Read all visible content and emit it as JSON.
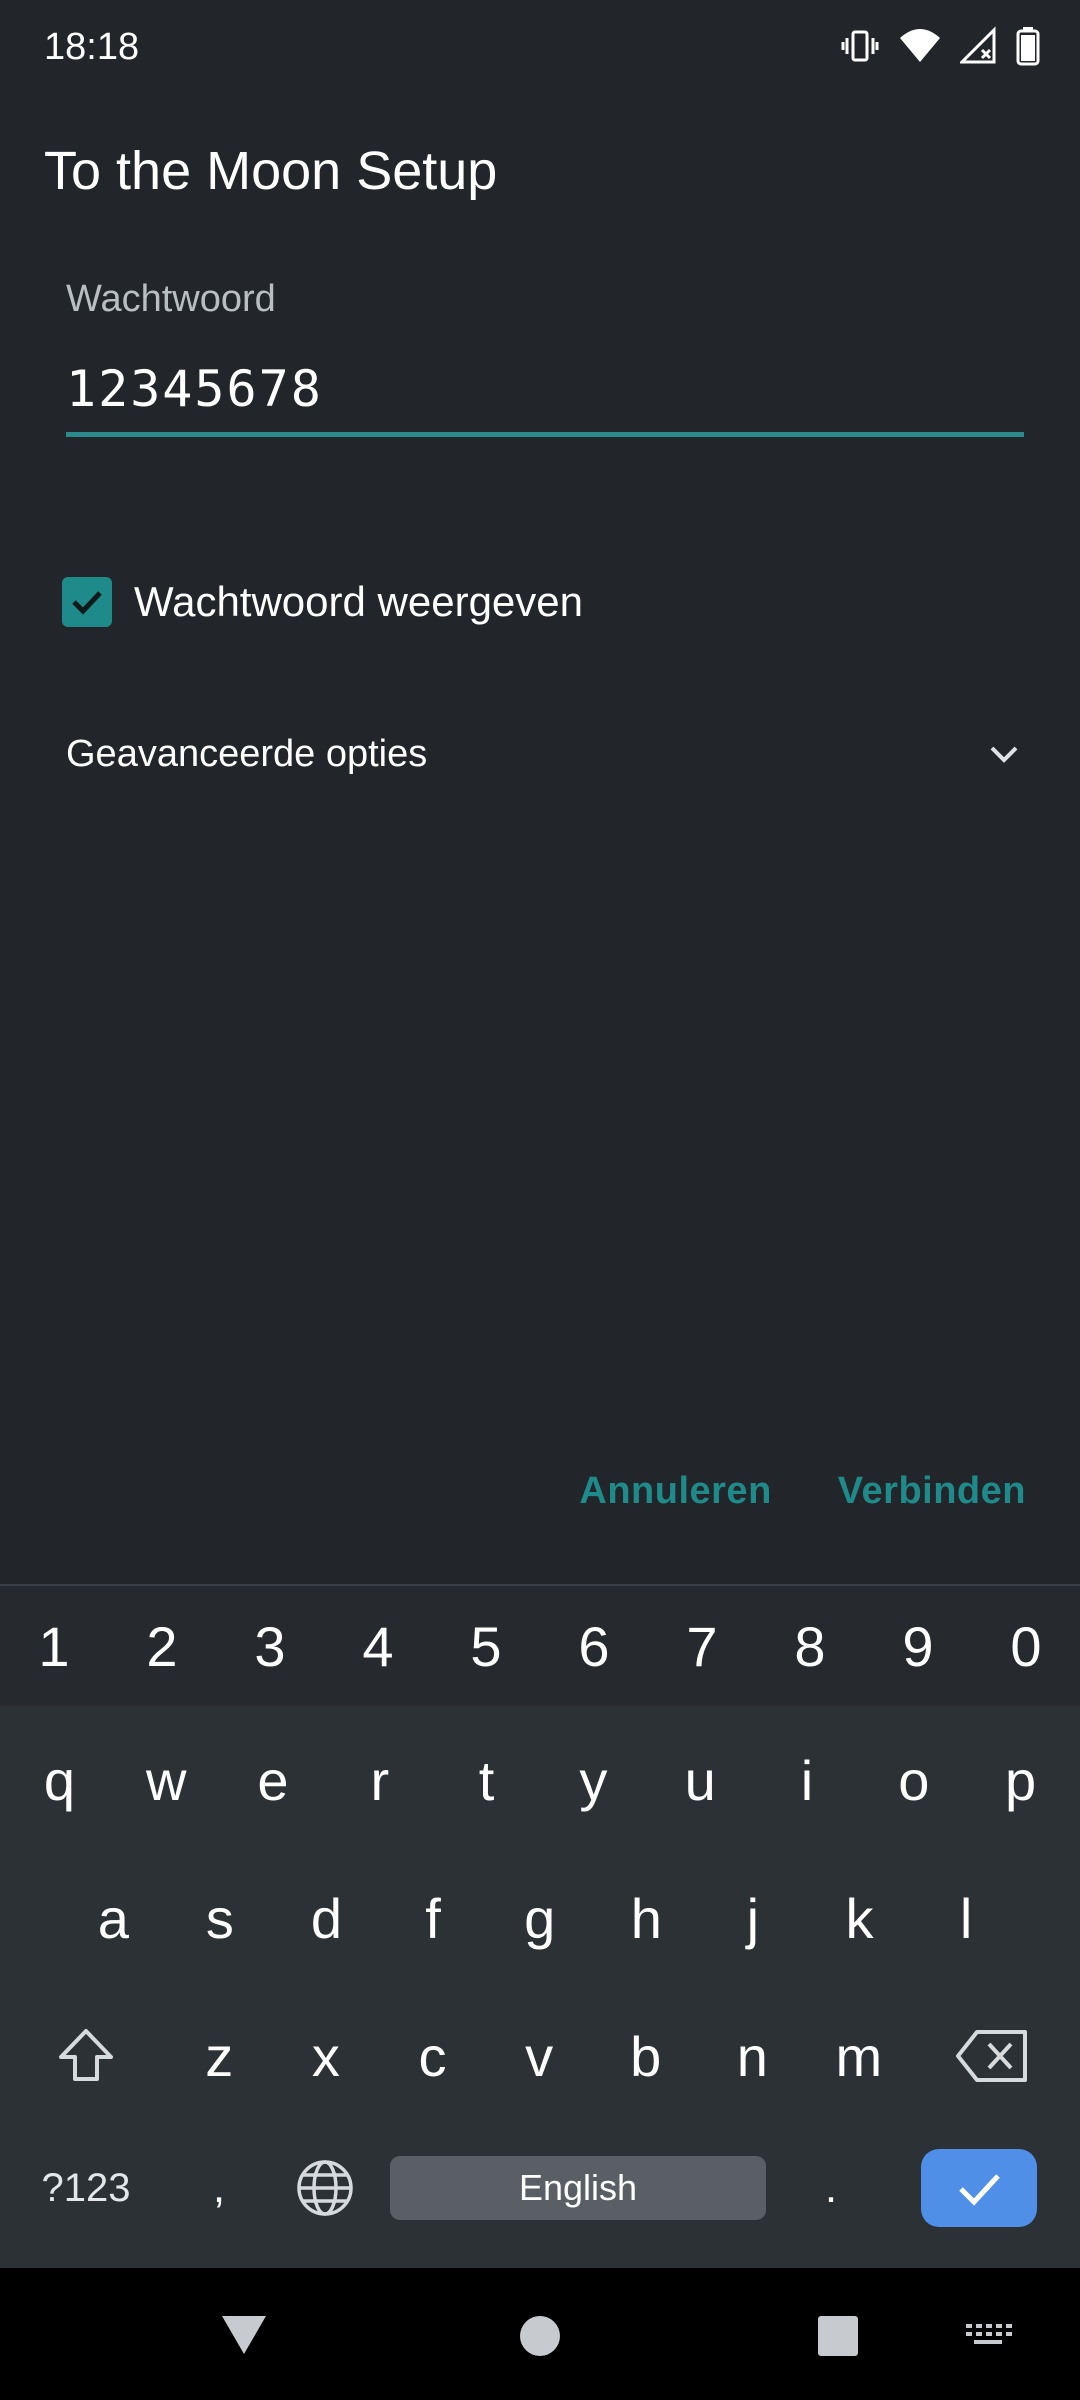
{
  "status_bar": {
    "time": "18:18",
    "icons": [
      "vibrate-icon",
      "wifi-icon",
      "cell-signal-no-service-icon",
      "battery-icon"
    ]
  },
  "app_bar": {
    "title": "To the Moon Setup"
  },
  "form": {
    "password_label": "Wachtwoord",
    "password_value": "12345678",
    "show_password_label": "Wachtwoord weergeven",
    "show_password_checked": true,
    "advanced_options_label": "Geavanceerde opties"
  },
  "actions": {
    "cancel_label": "Annuleren",
    "connect_label": "Verbinden"
  },
  "colors": {
    "accent": "#1f8a8a",
    "background": "#22262b",
    "keyboard_bg": "#2c3136",
    "enter_key": "#4f8fe8"
  },
  "keyboard": {
    "number_row": [
      "1",
      "2",
      "3",
      "4",
      "5",
      "6",
      "7",
      "8",
      "9",
      "0"
    ],
    "row1": [
      "q",
      "w",
      "e",
      "r",
      "t",
      "y",
      "u",
      "i",
      "o",
      "p"
    ],
    "row2": [
      "a",
      "s",
      "d",
      "f",
      "g",
      "h",
      "j",
      "k",
      "l"
    ],
    "row3": [
      "z",
      "x",
      "c",
      "v",
      "b",
      "n",
      "m"
    ],
    "symbols_label": "?123",
    "comma": ",",
    "space_label": "English",
    "period": "."
  }
}
